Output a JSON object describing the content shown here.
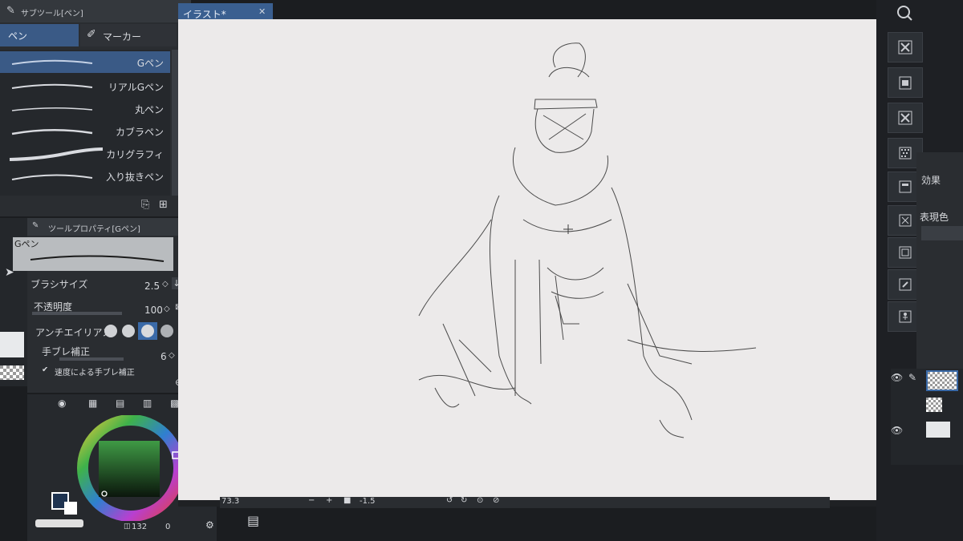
{
  "subtool_panel": {
    "title": "サブツール[ペン]",
    "tabs": [
      "ペン",
      "マーカー"
    ]
  },
  "brushes": [
    "Gペン",
    "リアルGペン",
    "丸ペン",
    "カブラペン",
    "カリグラフィ",
    "入り抜きペン"
  ],
  "tool_property": {
    "title": "ツールプロパティ[Gペン]",
    "preview_label": "Gペン",
    "brush_size_label": "ブラシサイズ",
    "brush_size_value": "2.5",
    "opacity_label": "不透明度",
    "opacity_value": "100",
    "antialias_label": "アンチエイリアス",
    "stabilization_label": "手ブレ補正",
    "stabilization_value": "6",
    "speed_label": "速度による手ブレ補正"
  },
  "color": {
    "main": "#2f8a3a",
    "value_readout": "132",
    "zero_readout": "0"
  },
  "canvas": {
    "tab_title": "イラスト*",
    "zoom": "73.3",
    "rotation": "-1.5"
  },
  "right_panel": {
    "effect_label": "効果",
    "expression_label": "表現色"
  }
}
